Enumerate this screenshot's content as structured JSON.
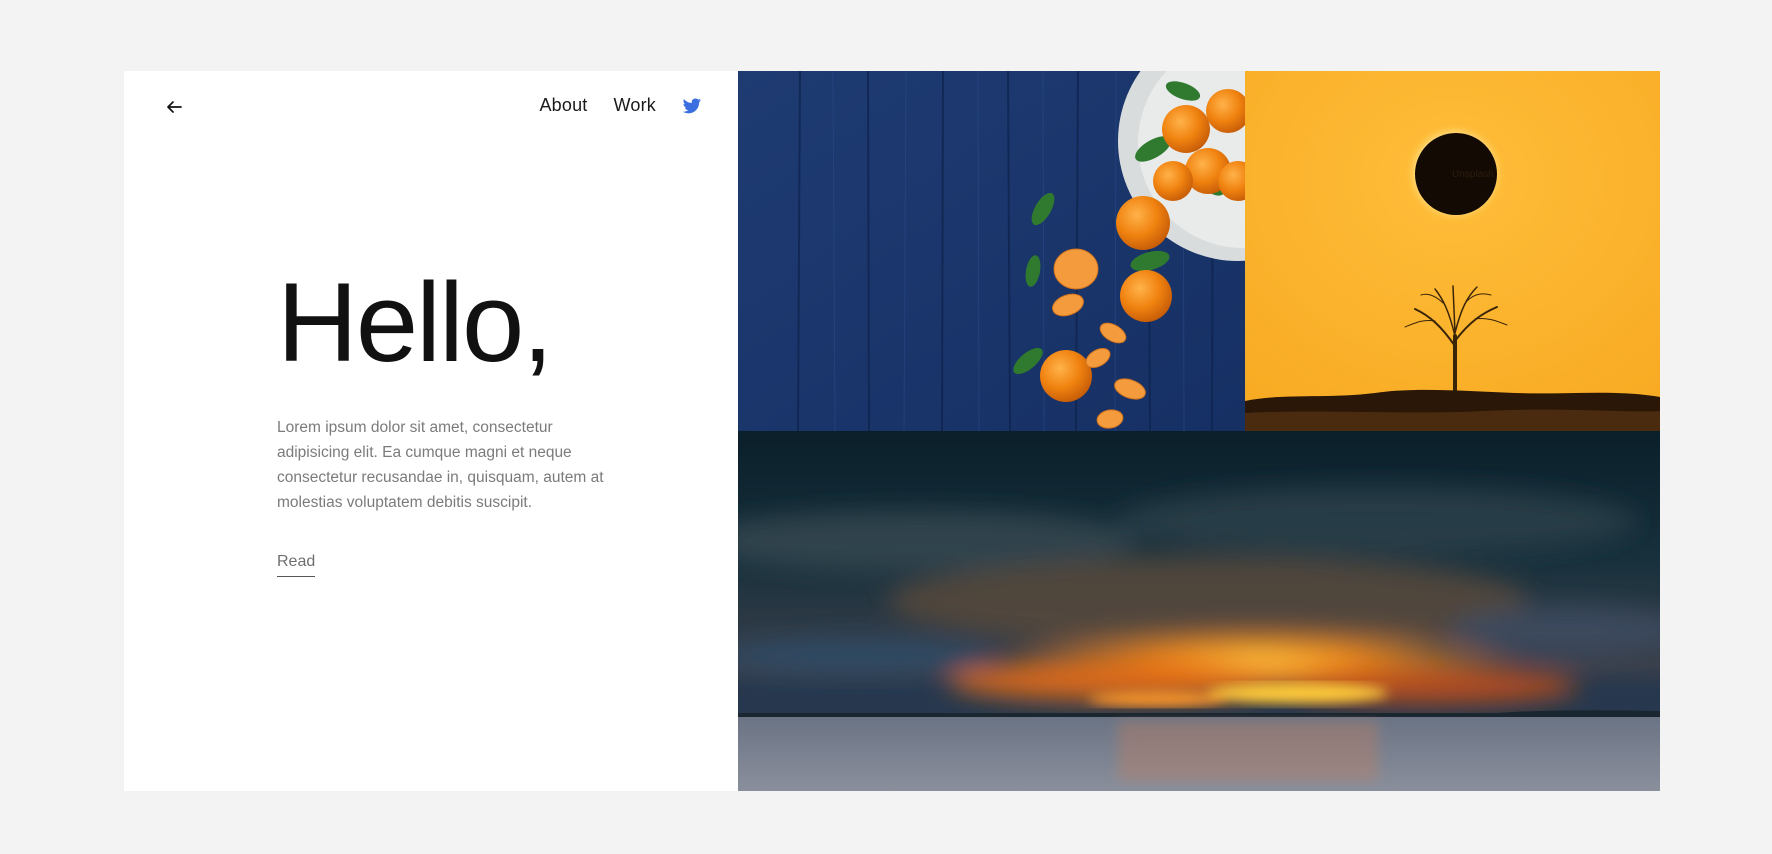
{
  "nav": {
    "back_icon": "arrow-left-icon",
    "links": [
      "About",
      "Work"
    ],
    "social_icon": "twitter-icon",
    "twitter_color": "#3b6fe0"
  },
  "hero": {
    "title": "Hello,",
    "body": "Lorem ipsum dolor sit amet, consectetur adipisicing elit. Ea cumque magni et neque consectetur recusandae in, quisquam, autem at molestias voluptatem debitis suscipit.",
    "link": "Read"
  },
  "gallery": {
    "images": [
      "oranges-on-blue-wood",
      "solar-eclipse-tree",
      "sunset-over-lake"
    ],
    "watermark": "Unsplash"
  },
  "colors": {
    "page_bg": "#f4f3f3",
    "card_bg": "#ffffff",
    "title": "#111111",
    "body_text": "#7b7b7b",
    "accent": "#3b6fe0"
  }
}
